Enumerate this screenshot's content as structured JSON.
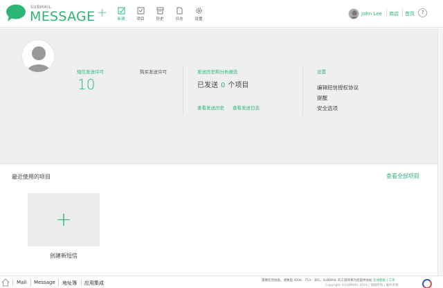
{
  "header": {
    "brand_small": "SUBMAIL",
    "brand_big": "MESSAGE",
    "add_symbol": "+",
    "nav": [
      {
        "label": "新建",
        "icon": "new-doc-icon"
      },
      {
        "label": "项目",
        "icon": "checklist-icon"
      },
      {
        "label": "历史",
        "icon": "archive-icon"
      },
      {
        "label": "日志",
        "icon": "file-icon"
      },
      {
        "label": "设置",
        "icon": "gear-icon"
      }
    ],
    "user_name": "John Lee",
    "store_link": "商店",
    "home_link": "首页",
    "help_label": "?"
  },
  "panel": {
    "send_permit_label": "短信发送许可",
    "buy_permit_label": "购买发送许可",
    "permit_count": "10",
    "history_label": "发送历史和分析报告",
    "sent_prefix": "已发送",
    "sent_count": "0",
    "sent_suffix": "个项目",
    "view_history": "查看发送历史",
    "view_log": "查看发送日志",
    "settings_label": "设置",
    "settings_links": [
      "编辑短信授权协议",
      "提醒",
      "安全选项"
    ]
  },
  "recent": {
    "title": "最近使用的项目",
    "view_all": "查看全部项目",
    "new_tile_plus": "+",
    "new_tile_label": "创建新短信"
  },
  "footer": {
    "links": [
      "Mail",
      "Message",
      "地址簿",
      "应用集成"
    ],
    "notice_prefix": "需要任何协助，请致电 4006 - 753 - 365，SUBMAIL 的工程师将为您提供协助",
    "notice_link1": "在线客服",
    "notice_link2": "工单",
    "copyright": "Copyright ©SUBMAIL 2014 | 保留所有 | 服务条款"
  },
  "colors": {
    "accent": "#2bb673",
    "panel_bg": "#efefef"
  }
}
